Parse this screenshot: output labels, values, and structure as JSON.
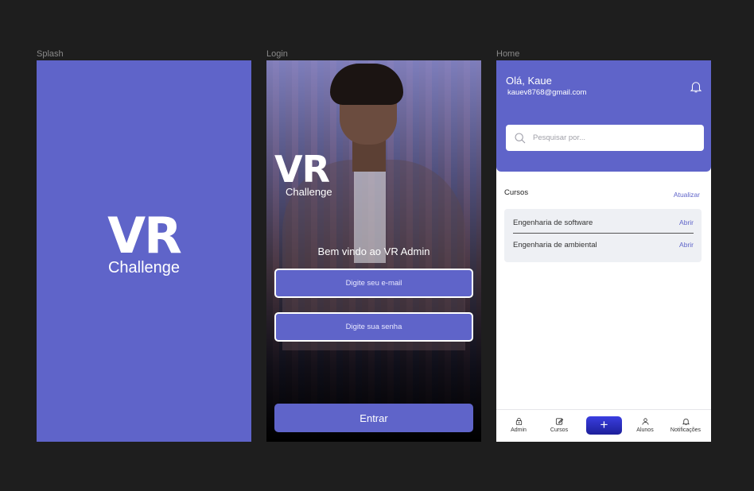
{
  "frames": {
    "splash": {
      "label": "Splash"
    },
    "login": {
      "label": "Login"
    },
    "home": {
      "label": "Home"
    }
  },
  "brand": {
    "logo_text": "VR",
    "logo_subtitle": "Challenge",
    "color": "#5f64c9"
  },
  "login": {
    "welcome": "Bem vindo ao VR Admin",
    "email_placeholder": "Digite seu e-mail",
    "password_placeholder": "Digite sua senha",
    "submit_label": "Entrar"
  },
  "home": {
    "greeting": "Olá, Kaue",
    "email": "kauev8768@gmail.com",
    "search_placeholder": "Pesquisar por...",
    "courses_title": "Cursos",
    "refresh_label": "Atualizar",
    "courses": [
      {
        "name": "Engenharia de software",
        "action": "Abrir"
      },
      {
        "name": "Engenharia de ambiental",
        "action": "Abrir"
      }
    ],
    "tabs": [
      {
        "label": "Admin",
        "icon": "lock-icon"
      },
      {
        "label": "Cursos",
        "icon": "edit-icon"
      },
      {
        "label": "+",
        "icon": "plus-icon"
      },
      {
        "label": "Alunos",
        "icon": "user-icon"
      },
      {
        "label": "Notificações",
        "icon": "bell-icon"
      }
    ]
  }
}
